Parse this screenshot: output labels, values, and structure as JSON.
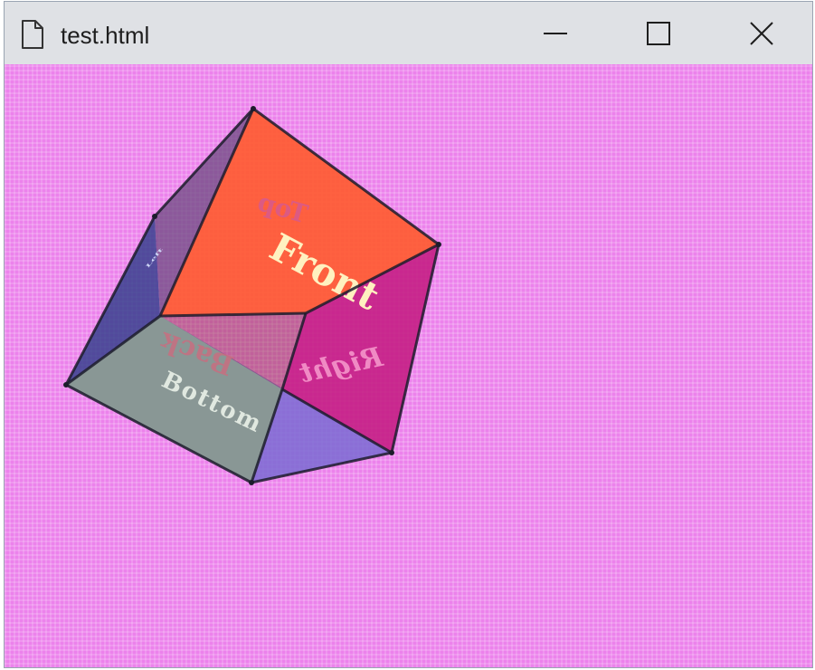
{
  "window": {
    "title": "test.html",
    "icon": "document-icon",
    "controls": [
      "minimize-icon",
      "maximize-icon",
      "close-icon"
    ]
  },
  "scene": {
    "background_color": "#ec82ec",
    "labels": {
      "front": "Front",
      "top": "Top",
      "right": "Right",
      "back": "Back",
      "bottom": "Bottom",
      "left": "Left"
    },
    "colors": {
      "front": "#ff5a2c",
      "right": "#c2187f",
      "bottom": "#889b8e",
      "left": "#2f3d8a",
      "top": "#7a4a8a",
      "back_bottom_right": "#7a6bd2",
      "edge": "#1c1c2c"
    }
  }
}
